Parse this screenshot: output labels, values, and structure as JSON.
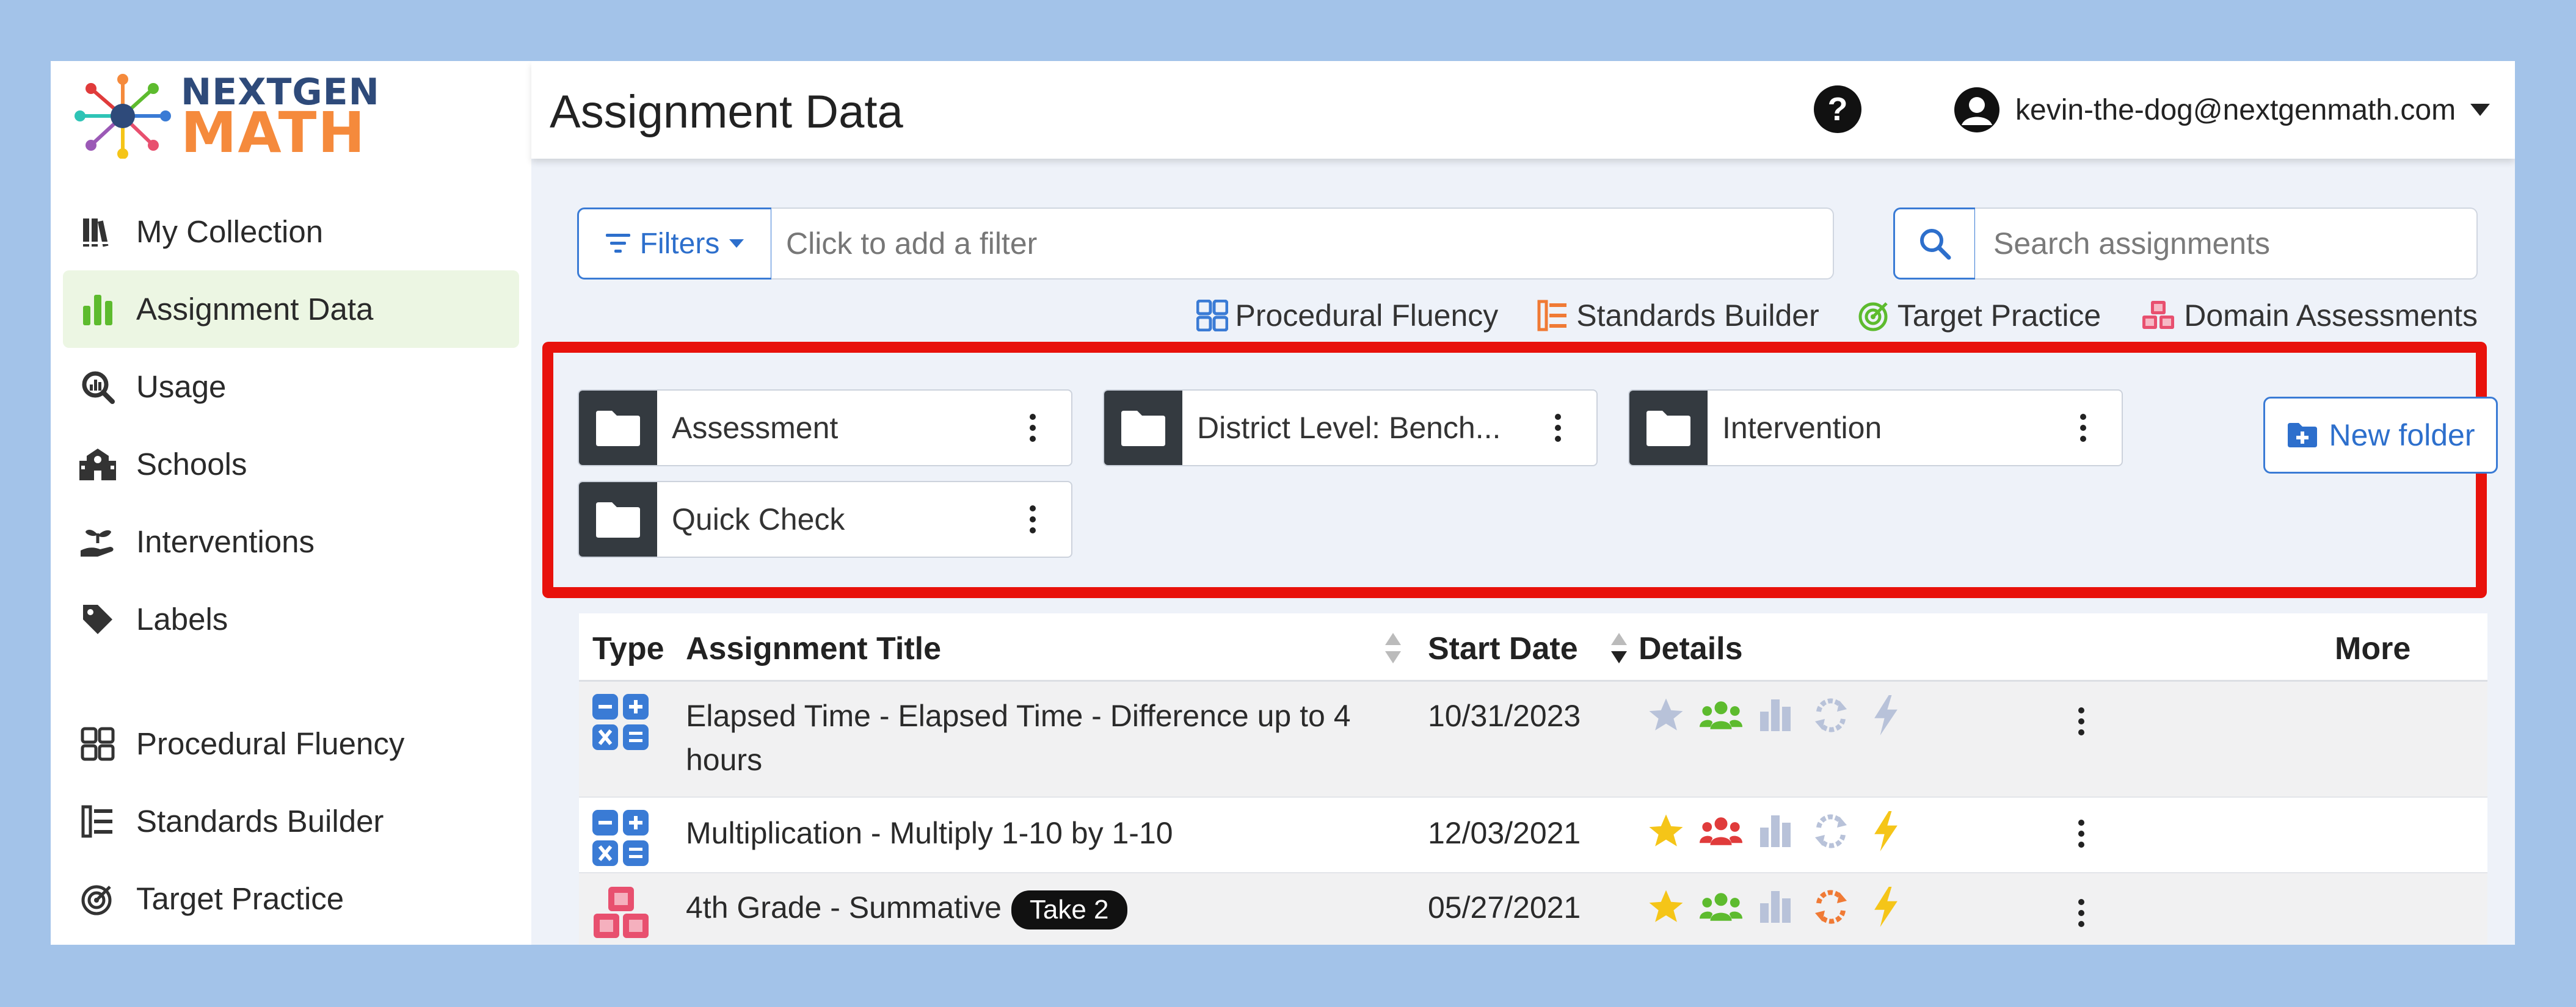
{
  "brand": {
    "line1": "NEXTGEN",
    "line2": "MATH"
  },
  "sidebar": {
    "items": [
      {
        "label": "My Collection",
        "icon": "books-icon",
        "active": false
      },
      {
        "label": "Assignment Data",
        "icon": "bar-chart-icon",
        "active": true
      },
      {
        "label": "Usage",
        "icon": "magnify-chart-icon",
        "active": false
      },
      {
        "label": "Schools",
        "icon": "school-icon",
        "active": false
      },
      {
        "label": "Interventions",
        "icon": "seedling-hand-icon",
        "active": false
      },
      {
        "label": "Labels",
        "icon": "tag-icon",
        "active": false
      },
      {
        "label": "Procedural Fluency",
        "icon": "grid-icon",
        "active": false
      },
      {
        "label": "Standards Builder",
        "icon": "list-tree-icon",
        "active": false
      },
      {
        "label": "Target Practice",
        "icon": "target-icon",
        "active": false
      }
    ]
  },
  "header": {
    "title": "Assignment Data",
    "help": "?",
    "user_email": "kevin-the-dog@nextgenmath.com"
  },
  "toolbar": {
    "filters_label": "Filters",
    "filter_placeholder": "Click to add a filter",
    "search_placeholder": "Search assignments"
  },
  "legend": [
    {
      "label": "Procedural Fluency",
      "icon": "grid-icon",
      "color": "#3a7bd5"
    },
    {
      "label": "Standards Builder",
      "icon": "list-tree-icon",
      "color": "#f07a35"
    },
    {
      "label": "Target Practice",
      "icon": "target-icon",
      "color": "#5dbb2e"
    },
    {
      "label": "Domain Assessments",
      "icon": "cubes-icon",
      "color": "#e8506f"
    }
  ],
  "folders": [
    {
      "name": "Assessment"
    },
    {
      "name": "District Level: Bench..."
    },
    {
      "name": "Intervention"
    },
    {
      "name": "Quick Check"
    }
  ],
  "new_folder_label": "New folder",
  "table": {
    "headers": {
      "type": "Type",
      "title": "Assignment Title",
      "start": "Start Date",
      "details": "Details",
      "more": "More"
    },
    "rows": [
      {
        "type": "procedural-fluency",
        "title": "Elapsed Time - Elapsed Time - Difference up to 4 hours",
        "badge": "",
        "start": "10/31/2023",
        "starred": false,
        "group_color": "#5dbb2e",
        "repeat_color": "#b8c2d9",
        "bolt_color": "#b8c2d9"
      },
      {
        "type": "procedural-fluency",
        "title": "Multiplication - Multiply 1-10 by 1-10",
        "badge": "",
        "start": "12/03/2021",
        "starred": true,
        "group_color": "#e03b3b",
        "repeat_color": "#b8c2d9",
        "bolt_color": "#f5c518"
      },
      {
        "type": "domain-assessment",
        "title": "4th Grade - Summative",
        "badge": "Take 2",
        "start": "05/27/2021",
        "starred": true,
        "group_color": "#5dbb2e",
        "repeat_color": "#f07a35",
        "bolt_color": "#f5c518"
      }
    ]
  },
  "colors": {
    "accent": "#3a7bd5",
    "highlight": "#e8120c",
    "active_nav": "#ecf6e3"
  }
}
